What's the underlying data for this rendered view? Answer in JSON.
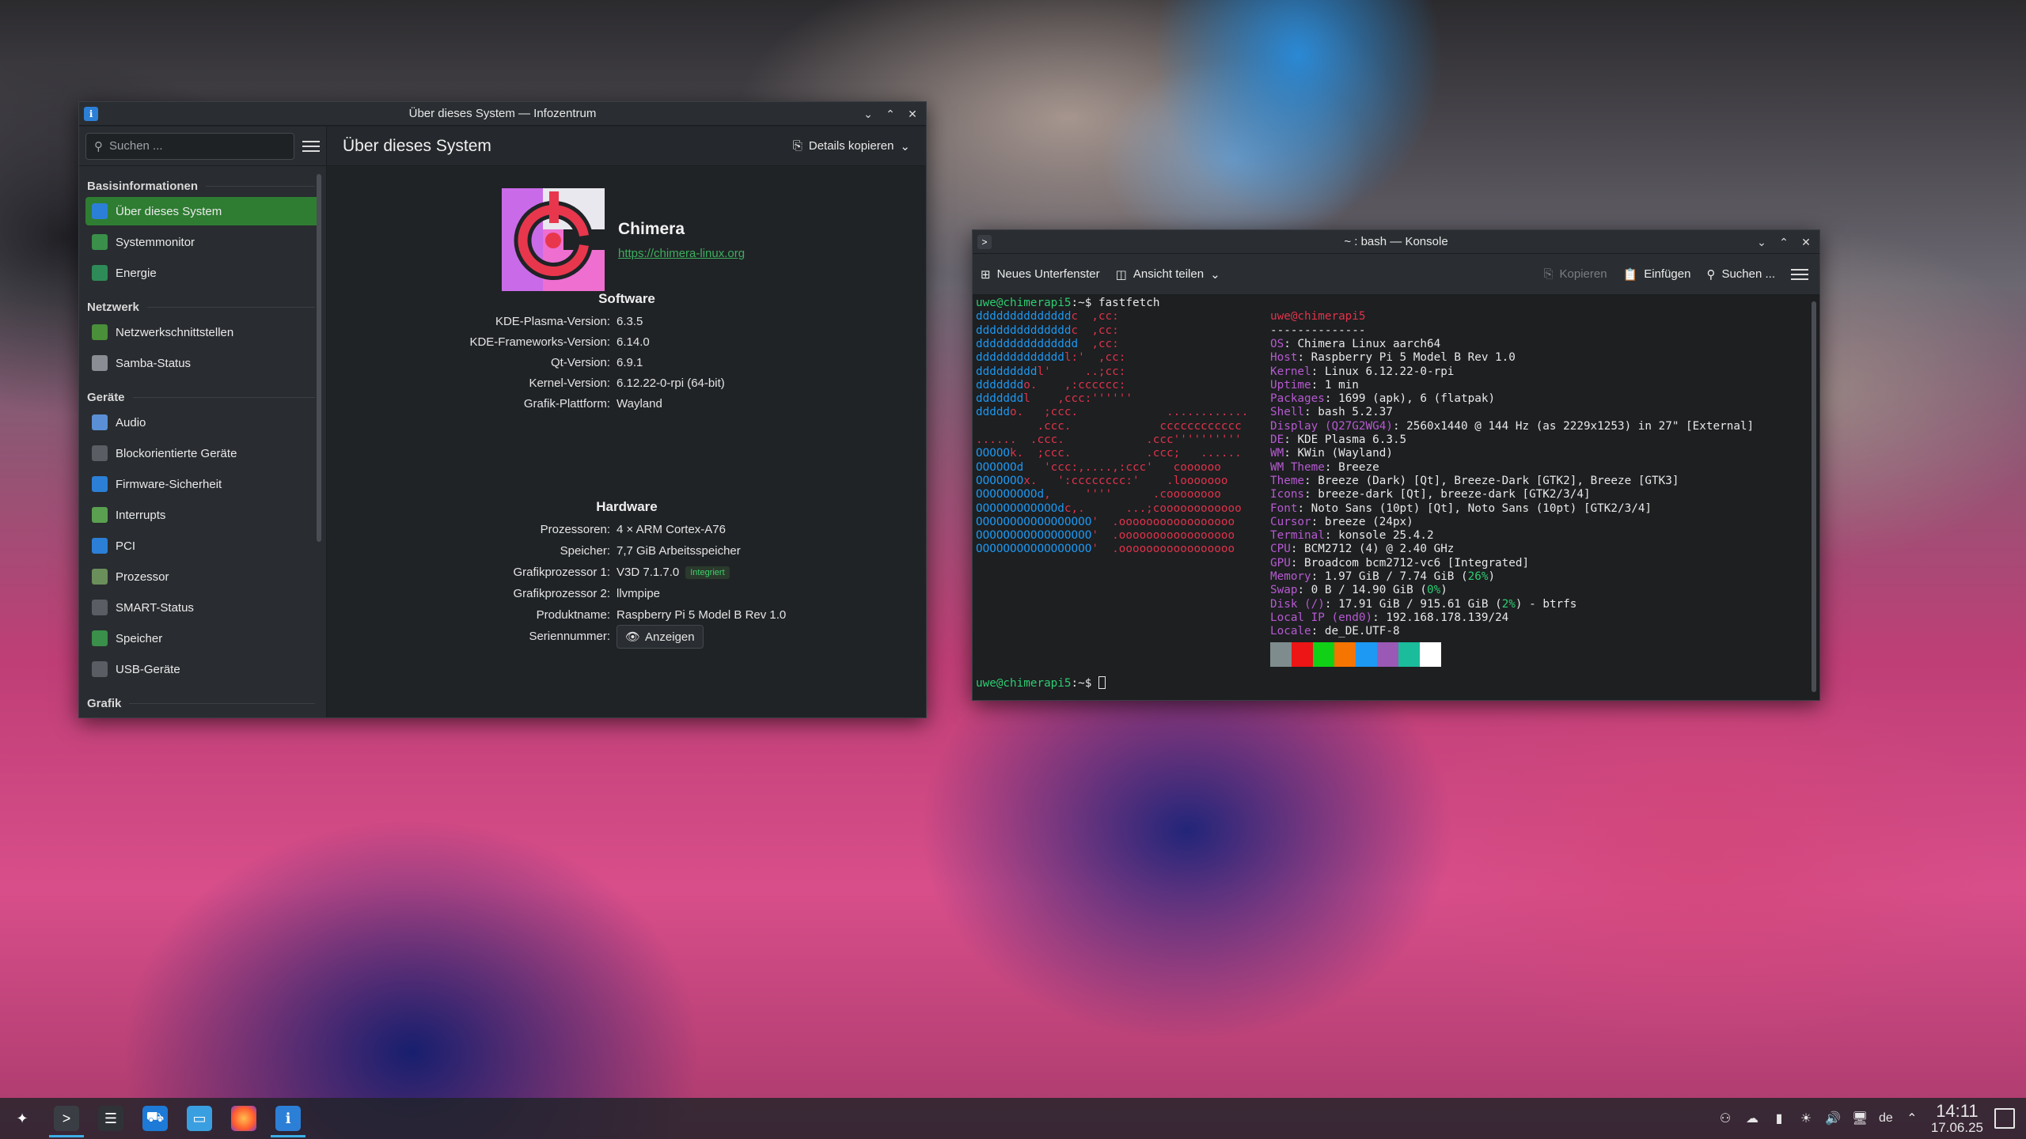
{
  "info": {
    "title": "Über dieses System — Infozentrum",
    "search_placeholder": "Suchen ...",
    "header": "Über dieses System",
    "copy_details": "Details kopieren",
    "categories": [
      {
        "name": "Basisinformationen",
        "items": [
          "Über dieses System",
          "Systemmonitor",
          "Energie"
        ]
      },
      {
        "name": "Netzwerk",
        "items": [
          "Netzwerkschnittstellen",
          "Samba-Status"
        ]
      },
      {
        "name": "Geräte",
        "items": [
          "Audio",
          "Blockorientierte Geräte",
          "Firmware-Sicherheit",
          "Interrupts",
          "PCI",
          "Prozessor",
          "SMART-Status",
          "Speicher",
          "USB-Geräte"
        ]
      },
      {
        "name": "Grafik",
        "items": []
      }
    ],
    "brand": "Chimera",
    "brand_url": "https://chimera-linux.org",
    "software_title": "Software",
    "software": [
      {
        "k": "KDE-Plasma-Version:",
        "v": "6.3.5"
      },
      {
        "k": "KDE-Frameworks-Version:",
        "v": "6.14.0"
      },
      {
        "k": "Qt-Version:",
        "v": "6.9.1"
      },
      {
        "k": "Kernel-Version:",
        "v": "6.12.22-0-rpi (64-bit)"
      },
      {
        "k": "Grafik-Plattform:",
        "v": "Wayland"
      }
    ],
    "hardware_title": "Hardware",
    "hardware": [
      {
        "k": "Prozessoren:",
        "v": "4 × ARM Cortex-A76"
      },
      {
        "k": "Speicher:",
        "v": "7,7 GiB Arbeitsspeicher"
      },
      {
        "k": "Grafikprozessor 1:",
        "v": "V3D 7.1.7.0",
        "badge": "Integriert"
      },
      {
        "k": "Grafikprozessor 2:",
        "v": "llvmpipe"
      },
      {
        "k": "Produktname:",
        "v": "Raspberry Pi 5 Model B Rev 1.0"
      },
      {
        "k": "Seriennummer:",
        "button": "Anzeigen"
      }
    ]
  },
  "konsole": {
    "title": "~ : bash — Konsole",
    "toolbar": {
      "new_tab": "Neues Unterfenster",
      "split": "Ansicht teilen",
      "copy": "Kopieren",
      "paste": "Einfügen",
      "find": "Suchen ..."
    },
    "prompt_user": "uwe@chimerapi5",
    "prompt_suffix": ":~$ ",
    "command": "fastfetch",
    "logo_lines": [
      "ddddddddddddddc  ,cc:",
      "ddddddddddddddc  ,cc:",
      "ddddddddddddddd  ,cc:",
      "dddddddddddddl:'  ,cc:",
      "dddddddddl'     ..;cc:",
      "dddddddo.    ,:cccccc:",
      "dddddddl    ,ccc:''''''",
      "dddddo.   ;ccc.             ............",
      "         .ccc.             cccccccccccc",
      "......  .ccc.            .ccc''''''''''",
      "OOOOOk.  ;ccc.           .ccc;   ......",
      "OOOOOOd   'ccc:,....,:ccc'   coooooo",
      "OOOOOOOx.   ':cccccccc:'    .looooooo",
      "OOOOOOOOOd,     ''''      .coooooooo",
      "OOOOOOOOOOOOdc,.      ...;coooooooooooo",
      "OOOOOOOOOOOOOOOOO'  .ooooooooooooooooo",
      "OOOOOOOOOOOOOOOOO'  .ooooooooooooooooo",
      "OOOOOOOOOOOOOOOOO'  .ooooooooooooooooo"
    ],
    "info_title": "uwe@chimerapi5",
    "info_sep": "--------------",
    "info_lines": [
      {
        "k": "OS",
        "v": "Chimera Linux aarch64"
      },
      {
        "k": "Host",
        "v": "Raspberry Pi 5 Model B Rev 1.0"
      },
      {
        "k": "Kernel",
        "v": "Linux 6.12.22-0-rpi"
      },
      {
        "k": "Uptime",
        "v": "1 min"
      },
      {
        "k": "Packages",
        "v": "1699 (apk), 6 (flatpak)"
      },
      {
        "k": "Shell",
        "v": "bash 5.2.37"
      },
      {
        "k": "Display (Q27G2WG4)",
        "v": "2560x1440 @ 144 Hz (as 2229x1253) in 27\" [External]"
      },
      {
        "k": "DE",
        "v": "KDE Plasma 6.3.5"
      },
      {
        "k": "WM",
        "v": "KWin (Wayland)"
      },
      {
        "k": "WM Theme",
        "v": "Breeze"
      },
      {
        "k": "Theme",
        "v": "Breeze (Dark) [Qt], Breeze-Dark [GTK2], Breeze [GTK3]"
      },
      {
        "k": "Icons",
        "v": "breeze-dark [Qt], breeze-dark [GTK2/3/4]"
      },
      {
        "k": "Font",
        "v": "Noto Sans (10pt) [Qt], Noto Sans (10pt) [GTK2/3/4]"
      },
      {
        "k": "Cursor",
        "v": "breeze (24px)"
      },
      {
        "k": "Terminal",
        "v": "konsole 25.4.2"
      },
      {
        "k": "CPU",
        "v": "BCM2712 (4) @ 2.40 GHz"
      },
      {
        "k": "GPU",
        "v": "Broadcom bcm2712-vc6 [Integrated]"
      },
      {
        "k": "Memory",
        "v": "1.97 GiB / 7.74 GiB (",
        "pct": "26%",
        "tail": ")"
      },
      {
        "k": "Swap",
        "v": "0 B / 14.90 GiB (",
        "pct": "0%",
        "tail": ")"
      },
      {
        "k": "Disk (/)",
        "v": "17.91 GiB / 915.61 GiB (",
        "pct": "2%",
        "tail": ") - btrfs"
      },
      {
        "k": "Local IP (end0)",
        "v": "192.168.178.139/24"
      },
      {
        "k": "Locale",
        "v": "de_DE.UTF-8"
      }
    ],
    "palette": [
      "#7f8c8d",
      "#ed1515",
      "#11d116",
      "#f67400",
      "#1d99f3",
      "#9b59b6",
      "#1abc9c",
      "#ffffff"
    ]
  },
  "taskbar": {
    "apps": [
      "launcher",
      "terminal",
      "system-settings",
      "discover",
      "file-manager",
      "firefox",
      "infocenter"
    ],
    "keyboard_layout": "de",
    "time": "14:11",
    "date": "17.06.25"
  },
  "colors": {
    "accent": "#2e7d32",
    "link": "#3dae5e",
    "prompt": "#2ecc71",
    "logo_blue": "#1d99f3",
    "logo_red": "#e0334a",
    "key": "#b65ad0"
  }
}
